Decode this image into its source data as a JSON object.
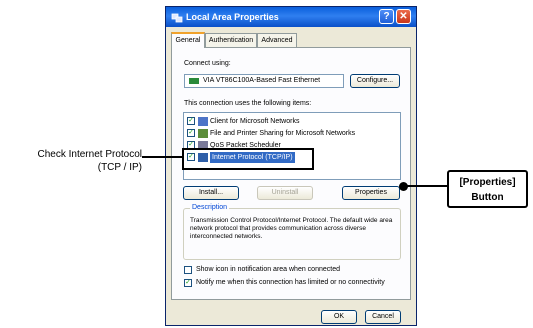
{
  "window": {
    "title": "Local Area Properties",
    "help_glyph": "?",
    "close_glyph": "✕"
  },
  "tabs": [
    {
      "label": "General"
    },
    {
      "label": "Authentication"
    },
    {
      "label": "Advanced"
    }
  ],
  "connect": {
    "label": "Connect using:",
    "adapter": "VIA VT86C100A-Based Fast Ethernet",
    "configure_label": "Configure..."
  },
  "items_label": "This connection uses the following items:",
  "items": [
    {
      "label": "Client for Microsoft Networks",
      "checked": true
    },
    {
      "label": "File and Printer Sharing for Microsoft Networks",
      "checked": true
    },
    {
      "label": "QoS Packet Scheduler",
      "checked": true
    },
    {
      "label": "Internet Protocol (TCP/IP)",
      "checked": true,
      "selected": true
    }
  ],
  "buttons": {
    "install": "Install...",
    "uninstall": "Uninstall",
    "properties": "Properties"
  },
  "description": {
    "title": "Description",
    "text": "Transmission Control Protocol/Internet Protocol. The default wide area network protocol that provides communication across diverse interconnected networks."
  },
  "options": [
    {
      "label": "Show icon in notification area when connected",
      "checked": false
    },
    {
      "label": "Notify me when this connection has limited or no connectivity",
      "checked": true
    }
  ],
  "footer": {
    "ok": "OK",
    "cancel": "Cancel"
  },
  "annotations": {
    "left_line1": "Check Internet Protocol",
    "left_line2": "(TCP / IP)",
    "right_line1": "[Properties]",
    "right_line2": "Button"
  },
  "colors": {
    "titlebar": "#0a5fdc",
    "selection": "#316ac5",
    "dialog_bg": "#ece9d8"
  }
}
